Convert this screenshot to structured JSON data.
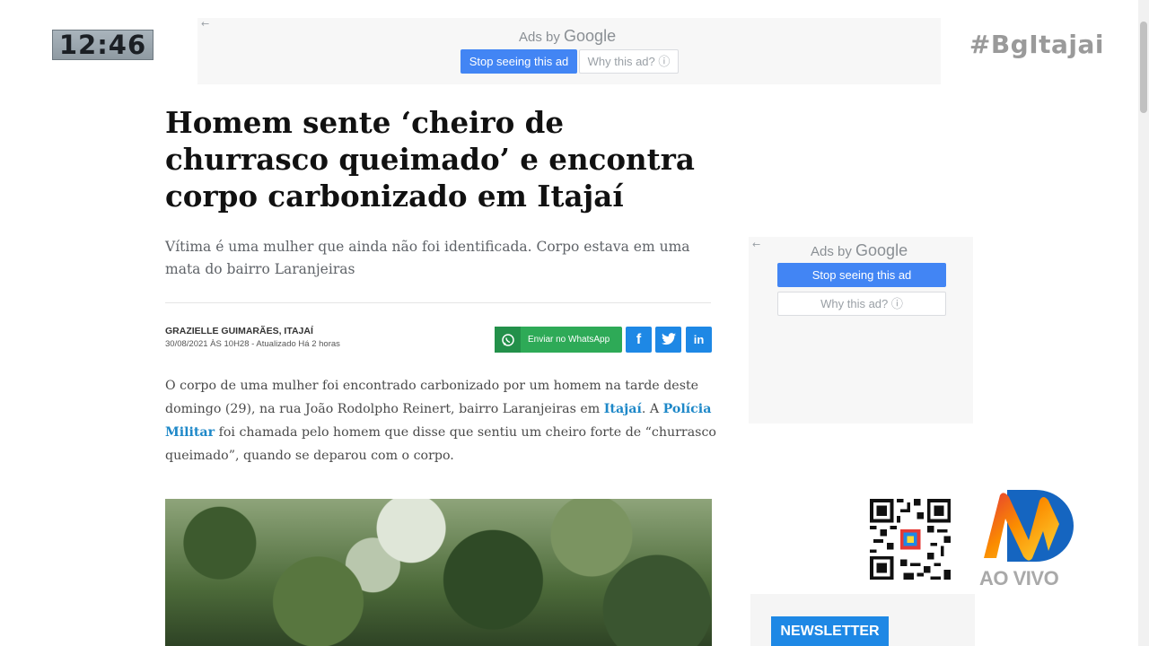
{
  "overlay": {
    "clock": "12:46",
    "hashtag": "#BgItajai"
  },
  "ad_top": {
    "ads_by": "Ads by",
    "google": "Google",
    "stop_label": "Stop seeing this ad",
    "why_label": "Why this ad? ⓘ",
    "back_arrow": "←"
  },
  "ad_side": {
    "ads_by": "Ads by",
    "google": "Google",
    "stop_label": "Stop seeing this ad",
    "why_label": "Why this ad? ⓘ",
    "back_arrow": "←"
  },
  "article": {
    "headline": "Homem sente ‘cheiro de churrasco queimado’ e encontra corpo carbonizado em Itajaí",
    "subtitle": "Vítima é uma mulher que ainda não foi identificada. Corpo estava em uma mata do bairro Laranjeiras",
    "author": "GRAZIELLE GUIMARÃES, ITAJAÍ",
    "date": "30/08/2021 ÀS 10H28 - Atualizado Há 2 horas",
    "body_part1": "O corpo de uma mulher foi encontrado carbonizado por um homem na tarde deste domingo (29), na rua João Rodolpho Reinert, bairro Laranjeiras em ",
    "link_itajai": "Itajaí",
    "body_part2": ". A ",
    "link_policia": "Polícia Militar",
    "body_part3": " foi chamada pelo homem que disse que sentiu um cheiro forte de “churrasco queimado”, quando se deparou com o corpo."
  },
  "share": {
    "whatsapp_label": "Enviar no WhatsApp",
    "facebook_glyph": "f",
    "linkedin_glyph": "in"
  },
  "sidebar": {
    "ao_vivo": "AO VIVO",
    "newsletter": "NEWSLETTER"
  },
  "icons": {
    "whatsapp": "whatsapp-icon",
    "facebook": "facebook-icon",
    "twitter": "twitter-icon",
    "linkedin": "linkedin-icon",
    "qr": "qr-code-icon",
    "logo": "nd-logo-icon"
  },
  "colors": {
    "accent_blue": "#1e88e5",
    "whatsapp_green": "#2eaa57",
    "link_blue": "#1e88c8",
    "google_blue": "#4285f4"
  }
}
